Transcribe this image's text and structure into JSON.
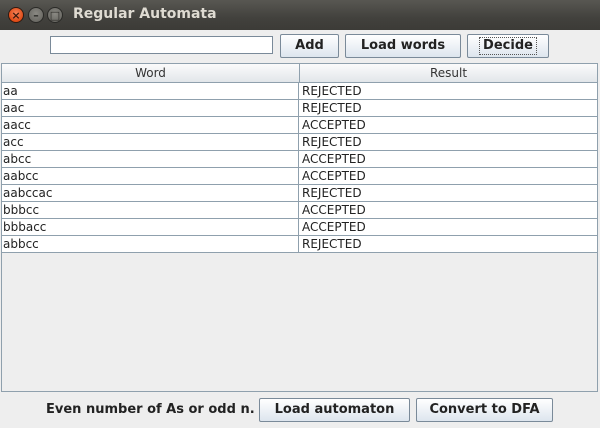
{
  "window": {
    "title": "Regular Automata",
    "close_glyph": "×",
    "minimize_glyph": "–",
    "maximize_glyph": "□"
  },
  "toolbar": {
    "word_input_value": "",
    "add_label": "Add",
    "load_words_label": "Load words",
    "decide_label": "Decide"
  },
  "table": {
    "columns": [
      "Word",
      "Result"
    ],
    "rows": [
      {
        "word": "aa",
        "result": "REJECTED"
      },
      {
        "word": "aac",
        "result": "REJECTED"
      },
      {
        "word": "aacc",
        "result": "ACCEPTED"
      },
      {
        "word": "acc",
        "result": "REJECTED"
      },
      {
        "word": "abcc",
        "result": "ACCEPTED"
      },
      {
        "word": "aabcc",
        "result": "ACCEPTED"
      },
      {
        "word": "aabccac",
        "result": "REJECTED"
      },
      {
        "word": "bbbcc",
        "result": "ACCEPTED"
      },
      {
        "word": "bbbacc",
        "result": "ACCEPTED"
      },
      {
        "word": "abbcc",
        "result": "REJECTED"
      }
    ]
  },
  "footer": {
    "automaton_description": "Even number of As or odd n...",
    "load_automaton_label": "Load automaton",
    "convert_label": "Convert to DFA"
  }
}
